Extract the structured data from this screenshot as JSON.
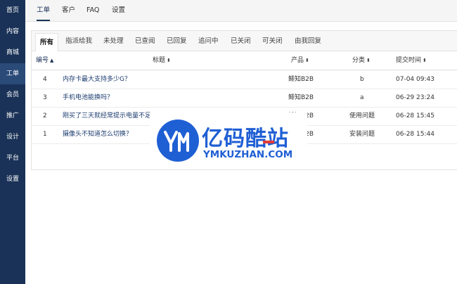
{
  "sidebar": {
    "items": [
      {
        "label": "首页"
      },
      {
        "label": "内容"
      },
      {
        "label": "商城"
      },
      {
        "label": "工单",
        "active": true
      },
      {
        "label": "会员"
      },
      {
        "label": "推广"
      },
      {
        "label": "设计"
      },
      {
        "label": "平台"
      },
      {
        "label": "设置"
      }
    ]
  },
  "topnav": {
    "tabs": [
      {
        "label": "工单",
        "active": true
      },
      {
        "label": "客户"
      },
      {
        "label": "FAQ"
      },
      {
        "label": "设置"
      }
    ]
  },
  "filters": {
    "tabs": [
      {
        "label": "所有",
        "active": true
      },
      {
        "label": "指派给我"
      },
      {
        "label": "未处理"
      },
      {
        "label": "已查阅"
      },
      {
        "label": "已回复"
      },
      {
        "label": "追问中"
      },
      {
        "label": "已关闭"
      },
      {
        "label": "可关闭"
      },
      {
        "label": "由我回复"
      }
    ]
  },
  "table": {
    "columns": [
      {
        "label": "编号",
        "sort": "asc"
      },
      {
        "label": "标题",
        "sort": "both"
      },
      {
        "label": "产品",
        "sort": "both"
      },
      {
        "label": "分类",
        "sort": "both"
      },
      {
        "label": "提交时间",
        "sort": "both"
      }
    ],
    "rows": [
      {
        "id": "4",
        "title": "内存卡最大支持多少G？",
        "product": "鲱知B2B",
        "category": "b",
        "time": "07-04 09:43"
      },
      {
        "id": "3",
        "title": "手机电池能换吗？",
        "product": "鲱知B2B",
        "category": "a",
        "time": "06-29 23:24"
      },
      {
        "id": "2",
        "title": "刚买了三天就经常提示电量不足",
        "product": "鲱知B2B",
        "category": "使用问题",
        "time": "06-28 15:45"
      },
      {
        "id": "1",
        "title": "摄像头不知道怎么切换？",
        "product": "鲱知B2B",
        "category": "安装问题",
        "time": "06-28 15:44"
      }
    ]
  },
  "watermark": {
    "cn": "亿码酷站",
    "en": "YMKUZHAN.COM",
    "brand_color": "#1f5fd4",
    "accent_color": "#e53935"
  },
  "icons": {
    "sort_asc": "▲",
    "sort_both": "⬍"
  }
}
